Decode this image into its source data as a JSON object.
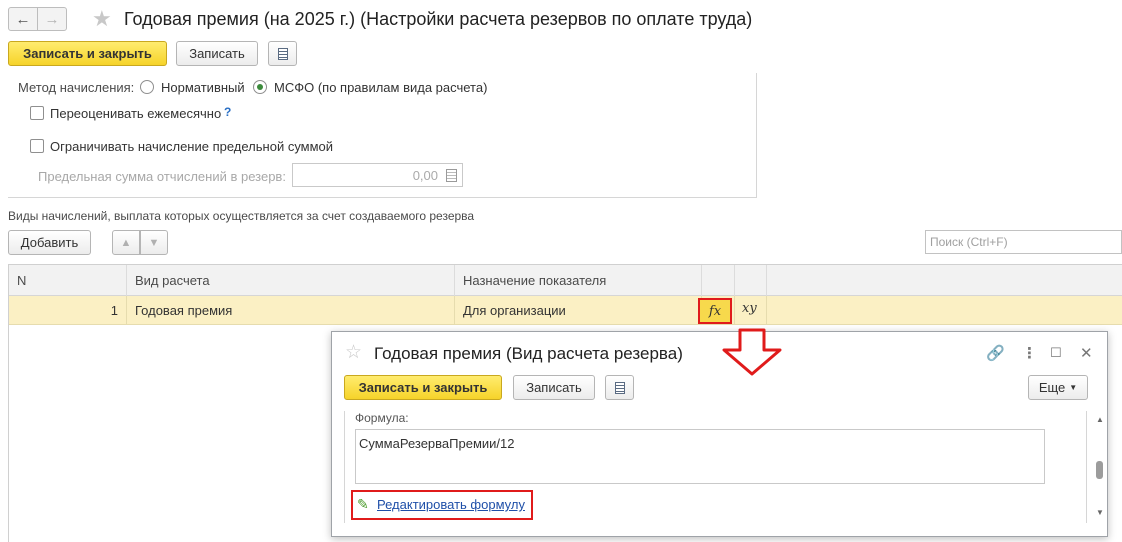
{
  "window": {
    "title": "Годовая премия (на 2025 г.) (Настройки расчета резервов по оплате труда)"
  },
  "toolbar": {
    "save_close_label": "Записать и закрыть",
    "save_label": "Записать"
  },
  "settings": {
    "method_label": "Метод начисления:",
    "method_options": [
      "Нормативный",
      "МСФО (по правилам вида расчета)"
    ],
    "method_selected": "МСФО (по правилам вида расчета)",
    "revalue_label": "Переоценивать ежемесячно",
    "revalue_help": "?",
    "revalue_checked": false,
    "limit_label": "Ограничивать начисление предельной суммой",
    "limit_checked": false,
    "max_sum_label": "Предельная сумма отчислений в резерв:",
    "max_sum_value": "0,00"
  },
  "accruals": {
    "section_title": "Виды начислений, выплата которых осуществляется за счет создаваемого резерва",
    "add_label": "Добавить",
    "search_placeholder": "Поиск (Ctrl+F)",
    "columns": [
      "N",
      "Вид расчета",
      "Назначение показателя"
    ],
    "rows": [
      {
        "n": "1",
        "calc_type": "Годовая премия",
        "purpose": "Для организации",
        "fx": "fx",
        "xy": "xy"
      }
    ]
  },
  "subform": {
    "title": "Годовая премия (Вид расчета резерва)",
    "save_close_label": "Записать и закрыть",
    "save_label": "Записать",
    "more_label": "Еще",
    "formula_label": "Формула:",
    "formula_value": "СуммаРезерваПремии/12",
    "edit_formula_link": "Редактировать формулу"
  },
  "colors": {
    "accent_yellow": "#f6d32a",
    "highlight_red": "#e01b1b",
    "selected_row": "#fbf0c4",
    "link_blue": "#1f4fa8"
  }
}
